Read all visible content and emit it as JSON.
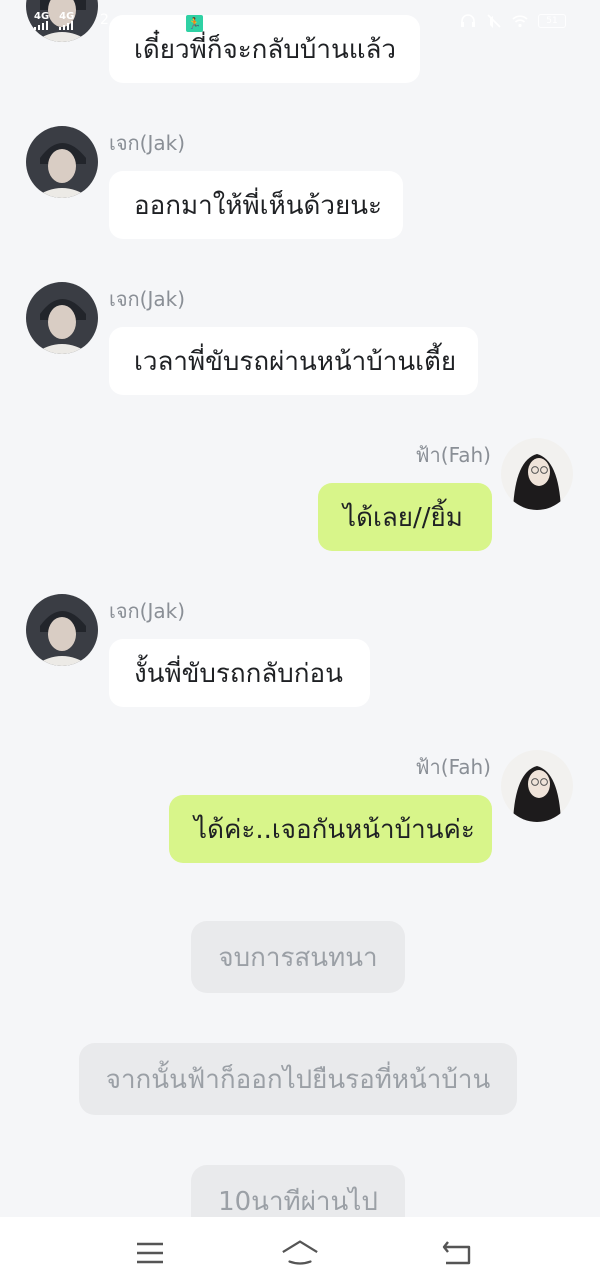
{
  "status_bar": {
    "net1": "4G",
    "net2": "4G",
    "time_fragment": "2",
    "battery": "51"
  },
  "colors": {
    "background": "#f5f6f8",
    "left_bubble": "#ffffff",
    "right_bubble": "#d8f58a",
    "narration_bg": "#e9eaec",
    "sender_text": "#8a8f96"
  },
  "messages": [
    {
      "side": "left",
      "sender": "",
      "text": "เดี๋ยวพี่ก็จะกลับบ้านแล้ว"
    },
    {
      "side": "left",
      "sender": "เจก(Jak)",
      "text": "ออกมาให้พี่เห็นด้วยนะ"
    },
    {
      "side": "left",
      "sender": "เจก(Jak)",
      "text": "เวลาพี่ขับรถผ่านหน้าบ้านเตี้ย"
    },
    {
      "side": "right",
      "sender": "ฟ้า(Fah)",
      "text": "ได้เลย//ยิ้ม"
    },
    {
      "side": "left",
      "sender": "เจก(Jak)",
      "text": "งั้นพี่ขับรถกลับก่อน"
    },
    {
      "side": "right",
      "sender": "ฟ้า(Fah)",
      "text": "ได้ค่ะ..เจอกันหน้าบ้านค่ะ"
    }
  ],
  "narrations": [
    "จบการสนทนา",
    "จากนั้นฟ้าก็ออกไปยืนรอที่หน้าบ้าน",
    "10นาทีผ่านไป"
  ],
  "nav": {
    "menu_icon": "menu-icon",
    "home_icon": "home-icon",
    "back_icon": "back-icon"
  }
}
